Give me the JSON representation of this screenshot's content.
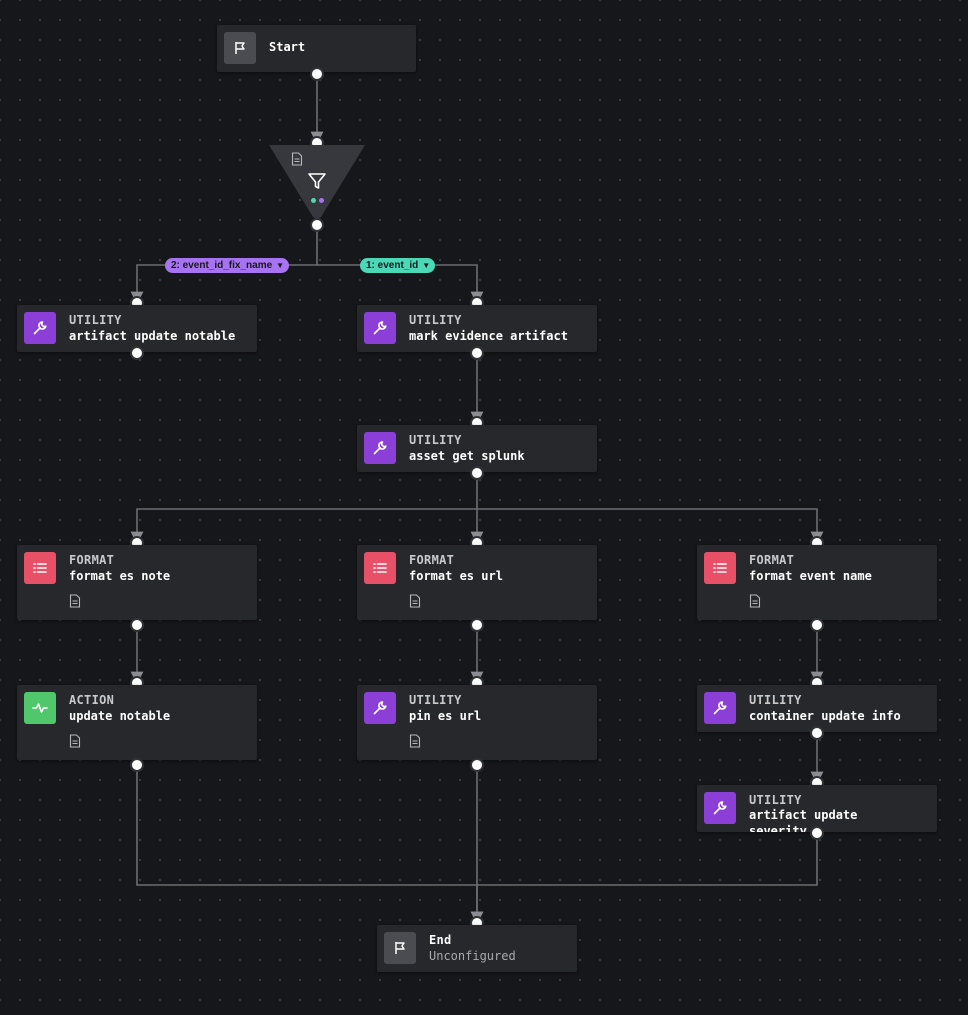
{
  "start": {
    "label": "Start"
  },
  "decision": {
    "icon": "filter-icon",
    "dot_colors": [
      "#4cd8b6",
      "#a873f0"
    ]
  },
  "branches": [
    {
      "label": "2: event_id_fix_name",
      "color": "#a873f0"
    },
    {
      "label": "1: event_id",
      "color": "#4cd8b6"
    }
  ],
  "nodes": {
    "artifact_update_notable": {
      "type": "UTILITY",
      "name": "artifact update notable",
      "icon": "wrench-icon"
    },
    "mark_evidence_artifact": {
      "type": "UTILITY",
      "name": "mark evidence artifact",
      "icon": "wrench-icon"
    },
    "asset_get_splunk": {
      "type": "UTILITY",
      "name": "asset get splunk",
      "icon": "wrench-icon"
    },
    "format_es_note": {
      "type": "FORMAT",
      "name": "format es note",
      "icon": "list-icon"
    },
    "format_es_url": {
      "type": "FORMAT",
      "name": "format es url",
      "icon": "list-icon"
    },
    "format_event_name": {
      "type": "FORMAT",
      "name": "format event name",
      "icon": "list-icon"
    },
    "update_notable": {
      "type": "ACTION",
      "name": "update notable",
      "icon": "pulse-icon"
    },
    "pin_es_url": {
      "type": "UTILITY",
      "name": "pin es url",
      "icon": "wrench-icon"
    },
    "container_update_info": {
      "type": "UTILITY",
      "name": "container update info",
      "icon": "wrench-icon"
    },
    "artifact_update_severity": {
      "type": "UTILITY",
      "name": "artifact update severity",
      "icon": "wrench-icon"
    }
  },
  "end": {
    "label": "End",
    "status": "Unconfigured"
  },
  "colors": {
    "canvas": "#16171b",
    "node": "#27282c",
    "utility": "#8b3fd6",
    "format": "#e85068",
    "action": "#4fc76a",
    "wire": "#6b6d72"
  }
}
